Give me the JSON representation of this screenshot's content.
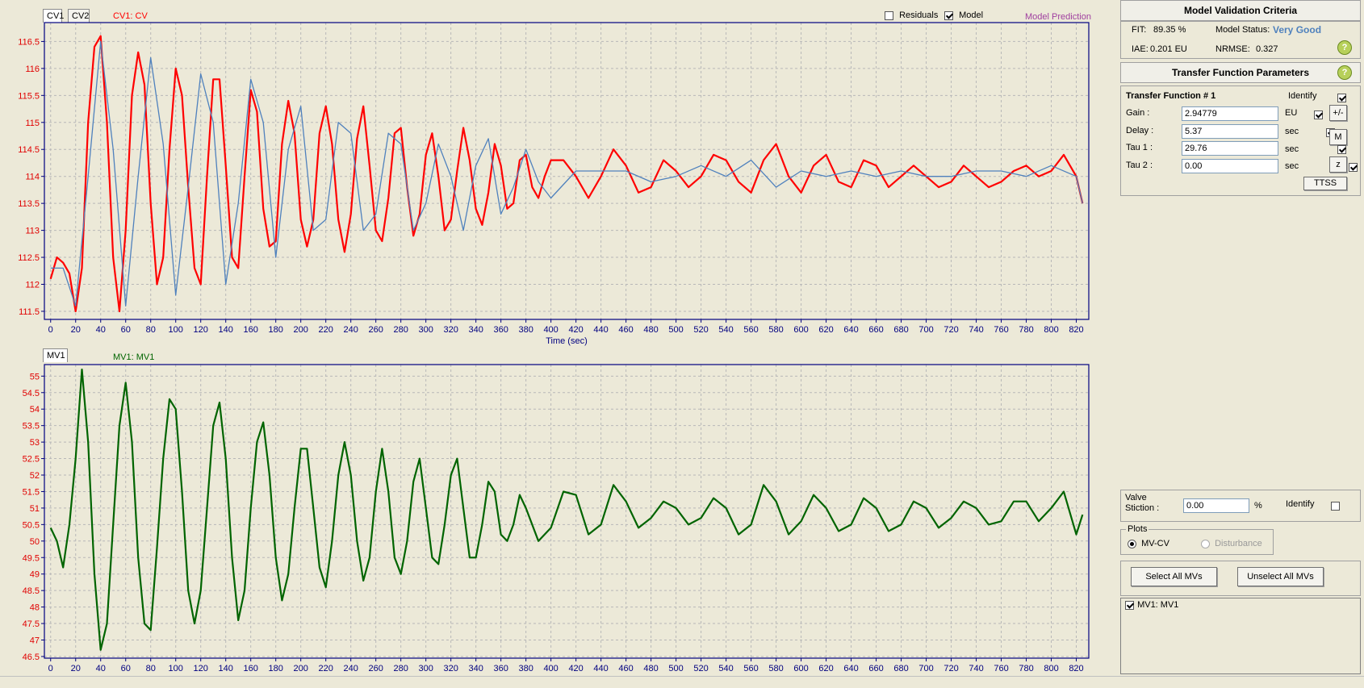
{
  "colors": {
    "cv_color": "#ff0000",
    "model_color": "#4f81bd",
    "mv_color": "#006400",
    "axis_label_red": "#e00000",
    "tick_blue": "#000080",
    "frame": "#000080",
    "model_pred_label": "#a040a0",
    "status_value": "#4f81bd"
  },
  "top_chart": {
    "tabs": [
      {
        "label": "CV1",
        "active": true
      },
      {
        "label": "CV2",
        "active": false
      }
    ],
    "series_label": "CV1: CV",
    "residuals_label": "Residuals",
    "residuals_checked": false,
    "model_label": "Model",
    "model_checked": true,
    "model_prediction_label": "Model Prediction",
    "xlabel": "Time (sec)"
  },
  "bottom_chart": {
    "tabs": [
      {
        "label": "MV1",
        "active": true
      }
    ],
    "series_label": "MV1: MV1"
  },
  "validation": {
    "title": "Model Validation Criteria",
    "fit_label": "FIT:",
    "fit_value": "89.35 %",
    "status_label": "Model Status:",
    "status_value": "Very Good",
    "iae_label": "IAE:",
    "iae_value": "0.201 EU",
    "nrmse_label": "NRMSE:",
    "nrmse_value": "0.327"
  },
  "tf": {
    "title": "Transfer Function Parameters",
    "subtitle": "Transfer Function # 1",
    "identify_label": "Identify",
    "identify_checked": true,
    "params": [
      {
        "label": "Gain :",
        "value": "2.94779",
        "unit": "EU",
        "checked": true
      },
      {
        "label": "Delay :",
        "value": "5.37",
        "unit": "sec",
        "checked": true
      },
      {
        "label": "Tau 1 :",
        "value": "29.76",
        "unit": "sec",
        "checked": true
      },
      {
        "label": "Tau 2 :",
        "value": "0.00",
        "unit": "sec",
        "checked": true
      }
    ],
    "buttons": {
      "plusminus": "+/-",
      "m": "M",
      "z": "z",
      "ttss": "TTSS"
    }
  },
  "valve": {
    "label_line1": "Valve",
    "label_line2": "Stiction :",
    "value": "0.00",
    "unit": "%",
    "identify_label": "Identify",
    "identify_checked": false
  },
  "plots": {
    "group_label": "Plots",
    "option1": "MV-CV",
    "option2": "Disturbance",
    "selected": "MV-CV"
  },
  "mv_buttons": {
    "select_all": "Select All MVs",
    "unselect_all": "Unselect All MVs"
  },
  "mv_list": [
    {
      "label": "MV1: MV1",
      "checked": true
    }
  ],
  "chart_data": [
    {
      "type": "line",
      "xlabel": "Time (sec)",
      "ylabel": "",
      "xlim": [
        -5,
        830
      ],
      "ylim": [
        111.35,
        116.85
      ],
      "xticks": [
        0,
        20,
        40,
        60,
        80,
        100,
        120,
        140,
        160,
        180,
        200,
        220,
        240,
        260,
        280,
        300,
        320,
        340,
        360,
        380,
        400,
        420,
        440,
        460,
        480,
        500,
        520,
        540,
        560,
        580,
        600,
        620,
        640,
        660,
        680,
        700,
        720,
        740,
        760,
        780,
        800,
        820
      ],
      "yticks": [
        111.5,
        112,
        112.5,
        113,
        113.5,
        114,
        114.5,
        115,
        115.5,
        116,
        116.5
      ],
      "grid": true,
      "series": [
        {
          "name": "CV1: CV",
          "color": "#ff0000",
          "x": [
            0,
            5,
            10,
            15,
            20,
            25,
            30,
            35,
            40,
            45,
            50,
            55,
            60,
            65,
            70,
            75,
            80,
            85,
            90,
            95,
            100,
            105,
            110,
            115,
            120,
            125,
            130,
            135,
            140,
            145,
            150,
            155,
            160,
            165,
            170,
            175,
            180,
            185,
            190,
            195,
            200,
            205,
            210,
            215,
            220,
            225,
            230,
            235,
            240,
            245,
            250,
            255,
            260,
            265,
            270,
            275,
            280,
            285,
            290,
            295,
            300,
            305,
            310,
            315,
            320,
            325,
            330,
            335,
            340,
            345,
            350,
            355,
            360,
            365,
            370,
            375,
            380,
            385,
            390,
            395,
            400,
            410,
            420,
            430,
            440,
            450,
            460,
            470,
            480,
            490,
            500,
            510,
            520,
            530,
            540,
            550,
            560,
            570,
            580,
            590,
            600,
            610,
            620,
            630,
            640,
            650,
            660,
            670,
            680,
            690,
            700,
            710,
            720,
            730,
            740,
            750,
            760,
            770,
            780,
            790,
            800,
            810,
            820,
            825
          ],
          "y": [
            112.1,
            112.5,
            112.4,
            112.2,
            111.5,
            112.3,
            115.0,
            116.4,
            116.6,
            115.0,
            112.5,
            111.5,
            113.0,
            115.5,
            116.3,
            115.7,
            113.5,
            112.0,
            112.5,
            114.5,
            116.0,
            115.5,
            113.8,
            112.3,
            112.0,
            114.0,
            115.8,
            115.8,
            114.2,
            112.5,
            112.3,
            114.0,
            115.6,
            115.2,
            113.4,
            112.7,
            112.8,
            114.6,
            115.4,
            114.8,
            113.2,
            112.7,
            113.2,
            114.8,
            115.3,
            114.6,
            113.2,
            112.6,
            113.3,
            114.7,
            115.3,
            114.2,
            113.0,
            112.8,
            113.6,
            114.8,
            114.9,
            113.8,
            112.9,
            113.3,
            114.4,
            114.8,
            114.0,
            113.0,
            113.2,
            114.1,
            114.9,
            114.3,
            113.4,
            113.1,
            113.7,
            114.6,
            114.2,
            113.4,
            113.5,
            114.3,
            114.4,
            113.8,
            113.6,
            114.0,
            114.3,
            114.3,
            114.0,
            113.6,
            114.0,
            114.5,
            114.2,
            113.7,
            113.8,
            114.3,
            114.1,
            113.8,
            114.0,
            114.4,
            114.3,
            113.9,
            113.7,
            114.3,
            114.6,
            114.0,
            113.7,
            114.2,
            114.4,
            113.9,
            113.8,
            114.3,
            114.2,
            113.8,
            114.0,
            114.2,
            114.0,
            113.8,
            113.9,
            114.2,
            114.0,
            113.8,
            113.9,
            114.1,
            114.2,
            114.0,
            114.1,
            114.4,
            114.0,
            113.5
          ]
        },
        {
          "name": "Model",
          "color": "#4f81bd",
          "x": [
            0,
            10,
            20,
            30,
            40,
            50,
            60,
            70,
            80,
            90,
            100,
            110,
            120,
            130,
            140,
            150,
            160,
            170,
            180,
            190,
            200,
            210,
            220,
            230,
            240,
            250,
            260,
            270,
            280,
            290,
            300,
            310,
            320,
            330,
            340,
            350,
            360,
            370,
            380,
            390,
            400,
            420,
            440,
            460,
            480,
            500,
            520,
            540,
            560,
            580,
            600,
            620,
            640,
            660,
            680,
            700,
            720,
            740,
            760,
            780,
            800,
            820,
            825
          ],
          "y": [
            112.3,
            112.3,
            111.6,
            114.0,
            116.5,
            114.5,
            111.6,
            114.0,
            116.2,
            114.6,
            111.8,
            113.8,
            115.9,
            115.0,
            112.0,
            113.5,
            115.8,
            115.0,
            112.5,
            114.5,
            115.3,
            113.0,
            113.2,
            115.0,
            114.8,
            113.0,
            113.3,
            114.8,
            114.6,
            113.0,
            113.5,
            114.6,
            114.0,
            113.0,
            114.2,
            114.7,
            113.3,
            113.8,
            114.5,
            113.9,
            113.6,
            114.1,
            114.1,
            114.1,
            113.9,
            114.0,
            114.2,
            114.0,
            114.3,
            113.8,
            114.1,
            114.0,
            114.1,
            114.0,
            114.1,
            114.0,
            114.0,
            114.1,
            114.1,
            114.0,
            114.2,
            114.0,
            113.5
          ]
        }
      ]
    },
    {
      "type": "line",
      "xlabel": "",
      "ylabel": "",
      "xlim": [
        -5,
        830
      ],
      "ylim": [
        46.45,
        55.35
      ],
      "xticks": [
        0,
        20,
        40,
        60,
        80,
        100,
        120,
        140,
        160,
        180,
        200,
        220,
        240,
        260,
        280,
        300,
        320,
        340,
        360,
        380,
        400,
        420,
        440,
        460,
        480,
        500,
        520,
        540,
        560,
        580,
        600,
        620,
        640,
        660,
        680,
        700,
        720,
        740,
        760,
        780,
        800,
        820
      ],
      "yticks": [
        46.5,
        47,
        47.5,
        48,
        48.5,
        49,
        49.5,
        50,
        50.5,
        51,
        51.5,
        52,
        52.5,
        53,
        53.5,
        54,
        54.5,
        55
      ],
      "grid": true,
      "series": [
        {
          "name": "MV1: MV1",
          "color": "#006400",
          "x": [
            0,
            5,
            10,
            15,
            20,
            25,
            30,
            35,
            40,
            45,
            50,
            55,
            60,
            65,
            70,
            75,
            80,
            85,
            90,
            95,
            100,
            105,
            110,
            115,
            120,
            125,
            130,
            135,
            140,
            145,
            150,
            155,
            160,
            165,
            170,
            175,
            180,
            185,
            190,
            195,
            200,
            205,
            210,
            215,
            220,
            225,
            230,
            235,
            240,
            245,
            250,
            255,
            260,
            265,
            270,
            275,
            280,
            285,
            290,
            295,
            300,
            305,
            310,
            315,
            320,
            325,
            330,
            335,
            340,
            345,
            350,
            355,
            360,
            365,
            370,
            375,
            380,
            390,
            400,
            410,
            420,
            430,
            440,
            450,
            460,
            470,
            480,
            490,
            500,
            510,
            520,
            530,
            540,
            550,
            560,
            570,
            580,
            590,
            600,
            610,
            620,
            630,
            640,
            650,
            660,
            670,
            680,
            690,
            700,
            710,
            720,
            730,
            740,
            750,
            760,
            770,
            780,
            790,
            800,
            810,
            820,
            825
          ],
          "y": [
            50.4,
            50.0,
            49.2,
            50.5,
            52.5,
            55.2,
            53.0,
            49.0,
            46.7,
            47.5,
            50.5,
            53.5,
            54.8,
            53.0,
            49.5,
            47.5,
            47.3,
            49.8,
            52.5,
            54.3,
            54.0,
            51.5,
            48.5,
            47.5,
            48.5,
            51.0,
            53.5,
            54.2,
            52.5,
            49.5,
            47.6,
            48.5,
            51.0,
            53.0,
            53.6,
            52.0,
            49.5,
            48.2,
            49.0,
            51.0,
            52.8,
            52.8,
            51.0,
            49.2,
            48.6,
            50.0,
            52.0,
            53.0,
            52.0,
            50.0,
            48.8,
            49.5,
            51.5,
            52.8,
            51.5,
            49.5,
            49.0,
            50.0,
            51.8,
            52.5,
            51.0,
            49.5,
            49.3,
            50.5,
            52.0,
            52.5,
            51.0,
            49.5,
            49.5,
            50.5,
            51.8,
            51.5,
            50.2,
            50.0,
            50.5,
            51.4,
            51.0,
            50.0,
            50.4,
            51.5,
            51.4,
            50.2,
            50.5,
            51.7,
            51.2,
            50.4,
            50.7,
            51.2,
            51.0,
            50.5,
            50.7,
            51.3,
            51.0,
            50.2,
            50.5,
            51.7,
            51.2,
            50.2,
            50.6,
            51.4,
            51.0,
            50.3,
            50.5,
            51.3,
            51.0,
            50.3,
            50.5,
            51.2,
            51.0,
            50.4,
            50.7,
            51.2,
            51.0,
            50.5,
            50.6,
            51.2,
            51.2,
            50.6,
            51.0,
            51.5,
            50.2,
            50.8
          ]
        }
      ]
    }
  ]
}
